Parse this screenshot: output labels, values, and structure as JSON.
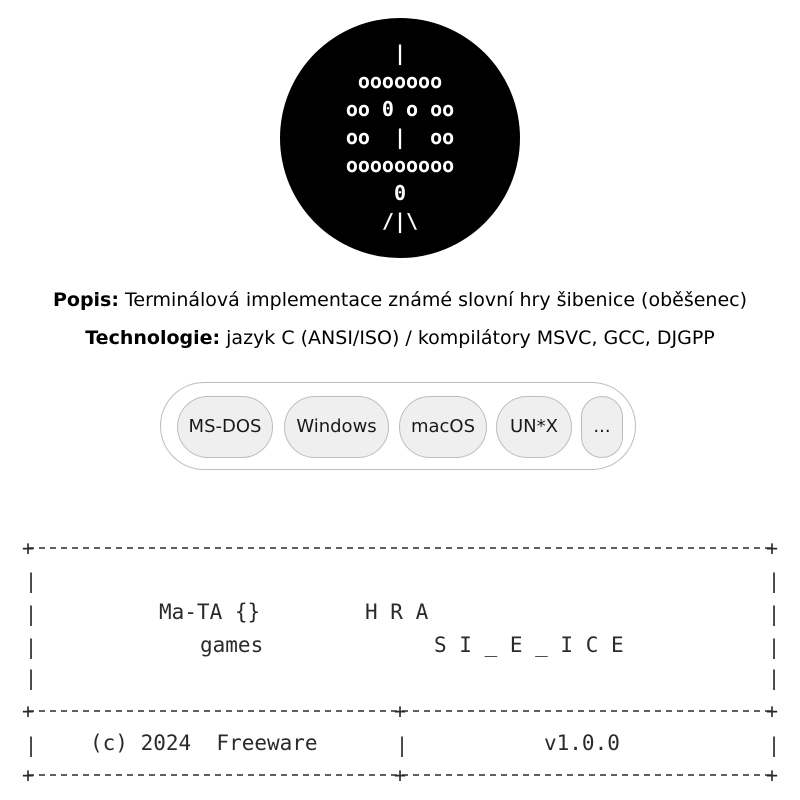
{
  "logo": {
    "ascii_lines": [
      "|",
      "ooooooo",
      "oo 0 o oo",
      "oo  |  oo",
      "ooooooooo",
      "0",
      "/|\\"
    ]
  },
  "info": {
    "description_label": "Popis:",
    "description_text": " Terminálová implementace známé slovní hry šibenice (oběšenec)",
    "technology_label": "Technologie:",
    "technology_text": " jazyk C (ANSI/ISO) / kompilátory MSVC, GCC, DJGPP"
  },
  "platforms": [
    "MS-DOS",
    "Windows",
    "macOS",
    "UN*X",
    "..."
  ],
  "banner": {
    "studio_line1": "Ma-TA {}",
    "studio_line2": "games",
    "game_line1": "H R A",
    "game_line2": "S I _ E _ I C E",
    "copyright": "(c) 2024  Freeware",
    "version": "v1.0.0"
  },
  "colors": {
    "logo_background": "#000000",
    "logo_text": "#ffffff",
    "tag_background": "#efefef",
    "tag_border": "#bdbdbd",
    "banner_text": "#2a2a2a"
  }
}
